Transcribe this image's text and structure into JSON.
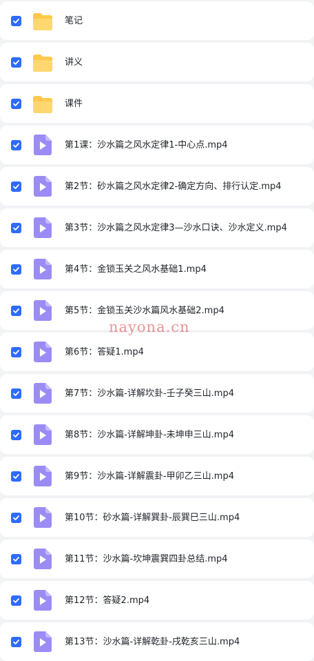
{
  "colors": {
    "background": "#f2f3f5",
    "row_background": "#ffffff",
    "checkbox": "#2f6bff",
    "folder": "#ffc94d",
    "video": "#9b8cf5",
    "text": "#1f2329",
    "watermark": "#dc3c3c"
  },
  "files": [
    {
      "name": "笔记",
      "type": "folder",
      "icon": "folder-icon",
      "checked": true
    },
    {
      "name": "讲义",
      "type": "folder",
      "icon": "folder-icon",
      "checked": true
    },
    {
      "name": "课件",
      "type": "folder",
      "icon": "folder-icon",
      "checked": true
    },
    {
      "name": "第1课：沙水篇之风水定律1-中心点.mp4",
      "type": "video",
      "icon": "video-file-icon",
      "checked": true
    },
    {
      "name": "第2节：砂水篇之风水定律2-确定方向、排行认定.mp4",
      "type": "video",
      "icon": "video-file-icon",
      "checked": true
    },
    {
      "name": "第3节：沙水篇之风水定律3—沙水口诀、沙水定义.mp4",
      "type": "video",
      "icon": "video-file-icon",
      "checked": true
    },
    {
      "name": "第4节：金锁玉关之风水基础1.mp4",
      "type": "video",
      "icon": "video-file-icon",
      "checked": true
    },
    {
      "name": "第5节：金锁玉关沙水篇风水基础2.mp4",
      "type": "video",
      "icon": "video-file-icon",
      "checked": true
    },
    {
      "name": "第6节：答疑1.mp4",
      "type": "video",
      "icon": "video-file-icon",
      "checked": true
    },
    {
      "name": "第7节：沙水篇-详解坎卦-壬子癸三山.mp4",
      "type": "video",
      "icon": "video-file-icon",
      "checked": true
    },
    {
      "name": "第8节：沙水篇-详解坤卦-未坤申三山.mp4",
      "type": "video",
      "icon": "video-file-icon",
      "checked": true
    },
    {
      "name": "第9节：沙水篇-详解震卦-甲卯乙三山.mp4",
      "type": "video",
      "icon": "video-file-icon",
      "checked": true
    },
    {
      "name": "第10节：砂水篇-详解巽卦-辰巽巳三山.mp4",
      "type": "video",
      "icon": "video-file-icon",
      "checked": true
    },
    {
      "name": "第11节：沙水篇-坎坤震巽四卦总结.mp4",
      "type": "video",
      "icon": "video-file-icon",
      "checked": true
    },
    {
      "name": "第12节：答疑2.mp4",
      "type": "video",
      "icon": "video-file-icon",
      "checked": true
    },
    {
      "name": "第13节：沙水篇-详解乾卦-戌乾亥三山.mp4",
      "type": "video",
      "icon": "video-file-icon",
      "checked": true
    }
  ],
  "watermark": "nayona.cn"
}
